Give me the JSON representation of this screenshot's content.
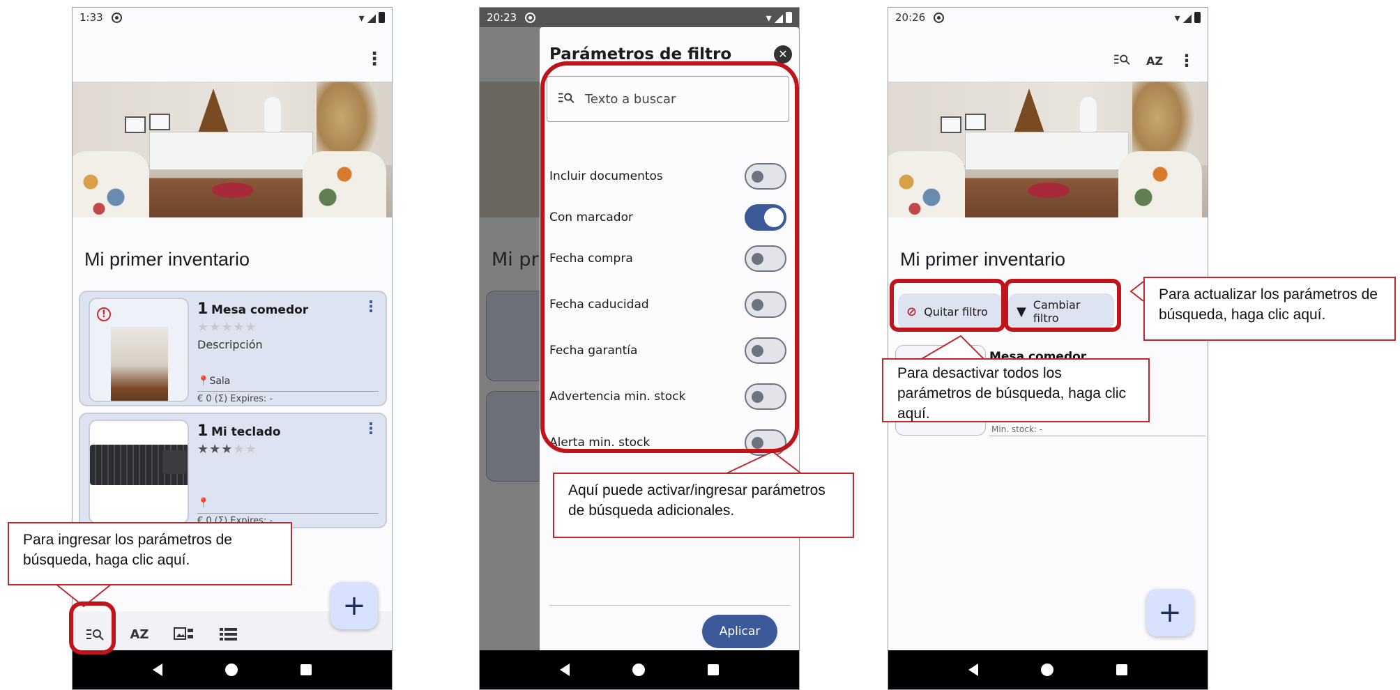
{
  "phones": {
    "one": {
      "time": "1:33",
      "title": "Mi primer inventario",
      "cards": [
        {
          "qty": "1",
          "name": "Mesa comedor",
          "description": "Descripción",
          "location": "Sala",
          "meta": "€ 0  (Σ)   Expires: -",
          "rating": "0 of 5"
        },
        {
          "qty": "1",
          "name": "Mi teclado",
          "description": "",
          "location": "",
          "meta": "€ 0  (Σ)   Expires: -",
          "rating": "3 of 5"
        }
      ],
      "bottom_icons": [
        "filter-search-icon",
        "sort-az-icon",
        "gallery-view-icon",
        "list-view-icon"
      ],
      "sort_label": "AZ"
    },
    "two": {
      "time": "20:23",
      "bg_title_fragment": "Mi pri",
      "dialog_title": "Parámetros de filtro",
      "search_placeholder": "Texto a buscar",
      "options": [
        {
          "label": "Incluir documentos",
          "on": false
        },
        {
          "label": "Con marcador",
          "on": true
        },
        {
          "label": "Fecha compra",
          "on": false
        },
        {
          "label": "Fecha caducidad",
          "on": false
        },
        {
          "label": "Fecha garantía",
          "on": false
        },
        {
          "label": "Advertencia min. stock",
          "on": false
        },
        {
          "label": "Alerta min. stock",
          "on": false
        }
      ],
      "apply_label": "Aplicar"
    },
    "three": {
      "time": "20:26",
      "title": "Mi primer inventario",
      "remove_filter_label": "Quitar filtro",
      "change_filter_label": "Cambiar filtro",
      "card_name": "Mesa comedor",
      "stock_fragment": "Min. stock: -",
      "sort_label": "AZ"
    }
  },
  "callouts": {
    "enter_params": "Para ingresar los parámetros de búsqueda, haga clic aquí.",
    "additional_params": "Aquí puede activar/ingresar parámetros de búsqueda adicionales.",
    "update_params": "Para actualizar los parámetros de búsqueda, haga clic aquí.",
    "disable_params": "Para desactivar todos los parámetros de búsqueda, haga clic aquí."
  },
  "colors": {
    "annotation_red": "#c0141b",
    "accent": "#3c5a99",
    "card_bg": "#dde3f1"
  }
}
